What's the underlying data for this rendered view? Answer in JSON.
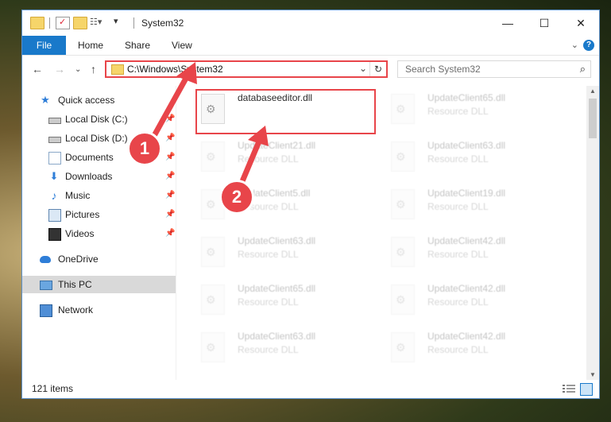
{
  "window": {
    "title": "System32"
  },
  "ribbon": {
    "tabs": [
      "File",
      "Home",
      "Share",
      "View"
    ]
  },
  "address": {
    "path": "C:\\Windows\\System32"
  },
  "search": {
    "placeholder": "Search System32"
  },
  "sidebar": {
    "items": [
      {
        "label": "Quick access",
        "pinned": false
      },
      {
        "label": "Local Disk (C:)",
        "pinned": true
      },
      {
        "label": "Local Disk (D:)",
        "pinned": true
      },
      {
        "label": "Documents",
        "pinned": true
      },
      {
        "label": "Downloads",
        "pinned": true
      },
      {
        "label": "Music",
        "pinned": true
      },
      {
        "label": "Pictures",
        "pinned": true
      },
      {
        "label": "Videos",
        "pinned": true
      },
      {
        "label": "OneDrive",
        "pinned": false
      },
      {
        "label": "This PC",
        "pinned": false,
        "selected": true
      },
      {
        "label": "Network",
        "pinned": false
      }
    ]
  },
  "files": {
    "main": {
      "name": "databaseeditor.dll",
      "type": ""
    },
    "left_column": [
      {
        "name": "UpdateClient21.dll",
        "type": "Resource DLL"
      },
      {
        "name": "UpdateClient5.dll",
        "type": "Resource DLL"
      },
      {
        "name": "UpdateClient63.dll",
        "type": "Resource DLL"
      },
      {
        "name": "UpdateClient65.dll",
        "type": "Resource DLL"
      },
      {
        "name": "UpdateClient63.dll",
        "type": "Resource DLL"
      }
    ],
    "right_column": [
      {
        "name": "UpdateClient65.dll",
        "type": "Resource DLL"
      },
      {
        "name": "UpdateClient63.dll",
        "type": "Resource DLL"
      },
      {
        "name": "UpdateClient19.dll",
        "type": "Resource DLL"
      },
      {
        "name": "UpdateClient42.dll",
        "type": "Resource DLL"
      },
      {
        "name": "UpdateClient42.dll",
        "type": "Resource DLL"
      },
      {
        "name": "UpdateClient42.dll",
        "type": "Resource DLL"
      }
    ]
  },
  "status": {
    "items_count": "121 items"
  },
  "annotations": {
    "step1": "1",
    "step2": "2"
  },
  "colors": {
    "accent": "#1979ca",
    "highlight": "#e8454a"
  }
}
